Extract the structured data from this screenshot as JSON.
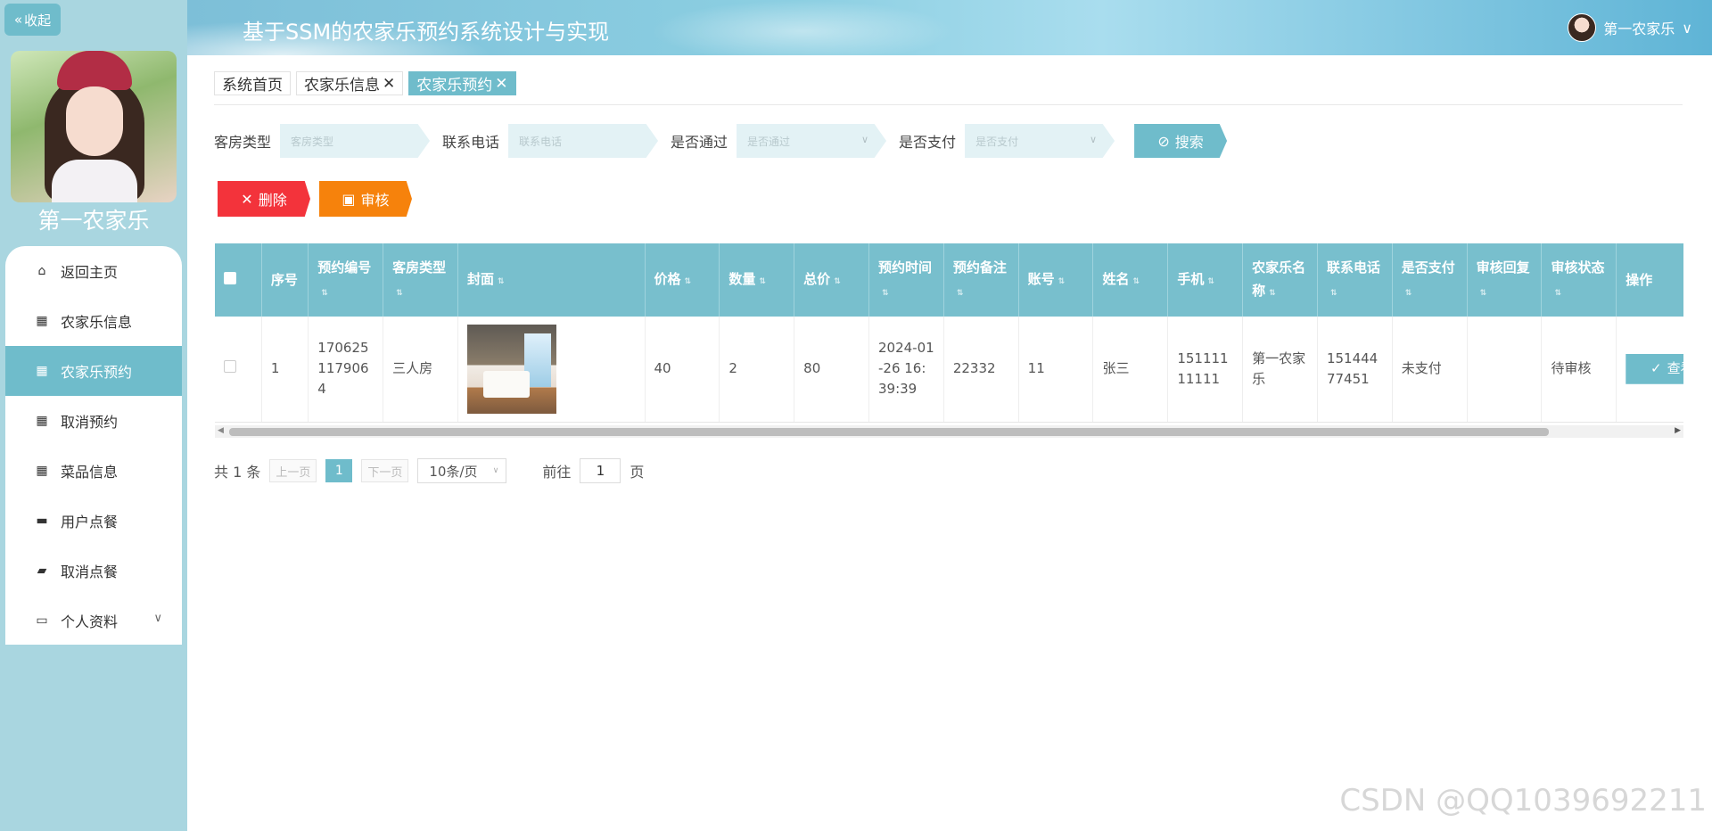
{
  "sidebar": {
    "collapse_label": "收起",
    "site_name": "第一农家乐",
    "menu": [
      {
        "label": "返回主页",
        "icon": "home-icon"
      },
      {
        "label": "农家乐信息",
        "icon": "grid-icon"
      },
      {
        "label": "农家乐预约",
        "icon": "grid-icon",
        "active": true
      },
      {
        "label": "取消预约",
        "icon": "grid-icon"
      },
      {
        "label": "菜品信息",
        "icon": "grid-icon"
      },
      {
        "label": "用户点餐",
        "icon": "briefcase-icon"
      },
      {
        "label": "取消点餐",
        "icon": "wallet-icon"
      },
      {
        "label": "个人资料",
        "icon": "card-icon",
        "has_arrow": true
      }
    ]
  },
  "header": {
    "title": "基于SSM的农家乐预约系统设计与实现",
    "user_name": "第一农家乐"
  },
  "tabs": [
    {
      "label": "系统首页",
      "closable": false
    },
    {
      "label": "农家乐信息",
      "closable": true
    },
    {
      "label": "农家乐预约",
      "closable": true,
      "active": true
    }
  ],
  "search": {
    "room_type": {
      "label": "客房类型",
      "placeholder": "客房类型"
    },
    "phone": {
      "label": "联系电话",
      "placeholder": "联系电话"
    },
    "passed": {
      "label": "是否通过",
      "placeholder": "是否通过"
    },
    "paid": {
      "label": "是否支付",
      "placeholder": "是否支付"
    },
    "button": "搜索"
  },
  "actions": {
    "delete": "删除",
    "audit": "审核"
  },
  "table": {
    "headers": [
      "序号",
      "预约编号",
      "客房类型",
      "封面",
      "价格",
      "数量",
      "总价",
      "预约时间",
      "预约备注",
      "账号",
      "姓名",
      "手机",
      "农家乐名称",
      "联系电话",
      "是否支付",
      "审核回复",
      "审核状态",
      "操作"
    ],
    "rows": [
      {
        "index": "1",
        "booking_no": "1706251179064",
        "room_type": "三人房",
        "price": "40",
        "quantity": "2",
        "total": "80",
        "time": "2024-01-26 16:39:39",
        "remark": "22332",
        "account": "11",
        "name": "张三",
        "mobile": "15111111111",
        "farm_name": "第一农家乐",
        "contact": "15144477451",
        "paid": "未支付",
        "reply": "",
        "status": "待审核",
        "view_label": "查看"
      }
    ]
  },
  "pager": {
    "total": "共 1 条",
    "prev": "上一页",
    "current": "1",
    "next": "下一页",
    "page_size": "10条/页",
    "goto_label": "前往",
    "goto_value": "1",
    "page_unit": "页"
  },
  "watermark": "CSDN @QQ1039692211",
  "colors": {
    "accent": "#6fbccb",
    "danger": "#f3333b",
    "warning": "#f6820c",
    "sidebar_bg": "#a9d6e0"
  }
}
